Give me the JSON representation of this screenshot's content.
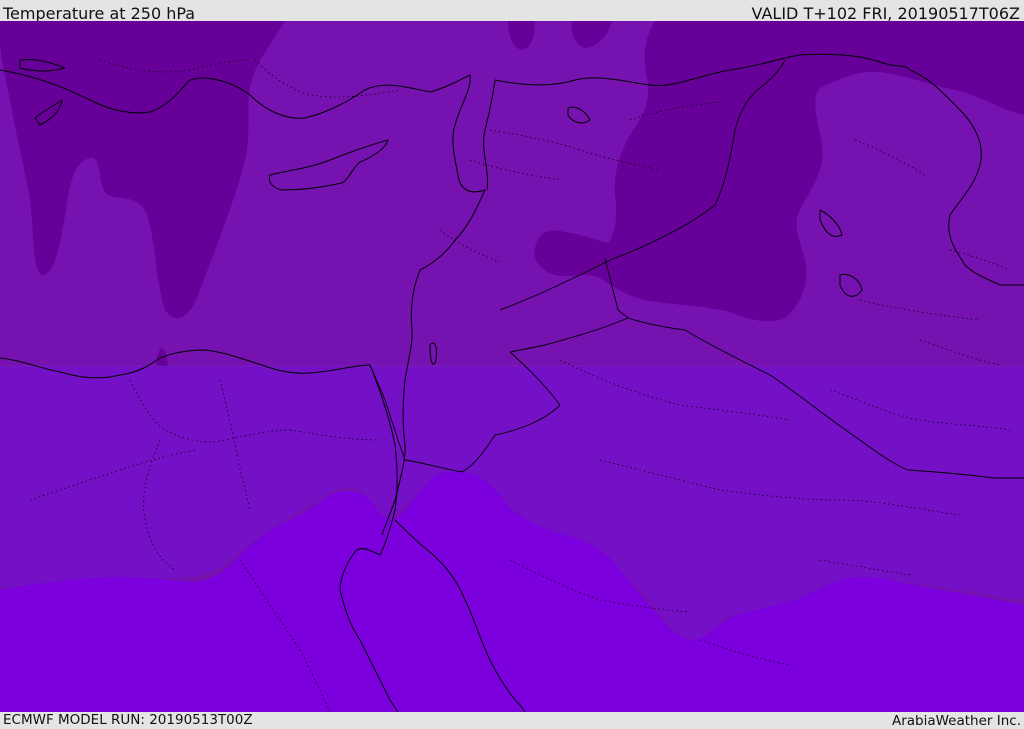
{
  "header": {
    "title": "Temperature at 250 hPa",
    "valid_time": "VALID T+102 FRI, 20190517T06Z"
  },
  "footer": {
    "model_run": "ECMWF MODEL RUN: 20190513T00Z",
    "credit": "ArabiaWeather Inc."
  },
  "map": {
    "field": "temperature",
    "level": "250 hPa",
    "legend_shown": false,
    "colors": {
      "coldest": "#660099",
      "cold": "#7512b0",
      "mid": "#7410c6",
      "warm": "#7c00dd",
      "border_line": "#000000"
    }
  }
}
